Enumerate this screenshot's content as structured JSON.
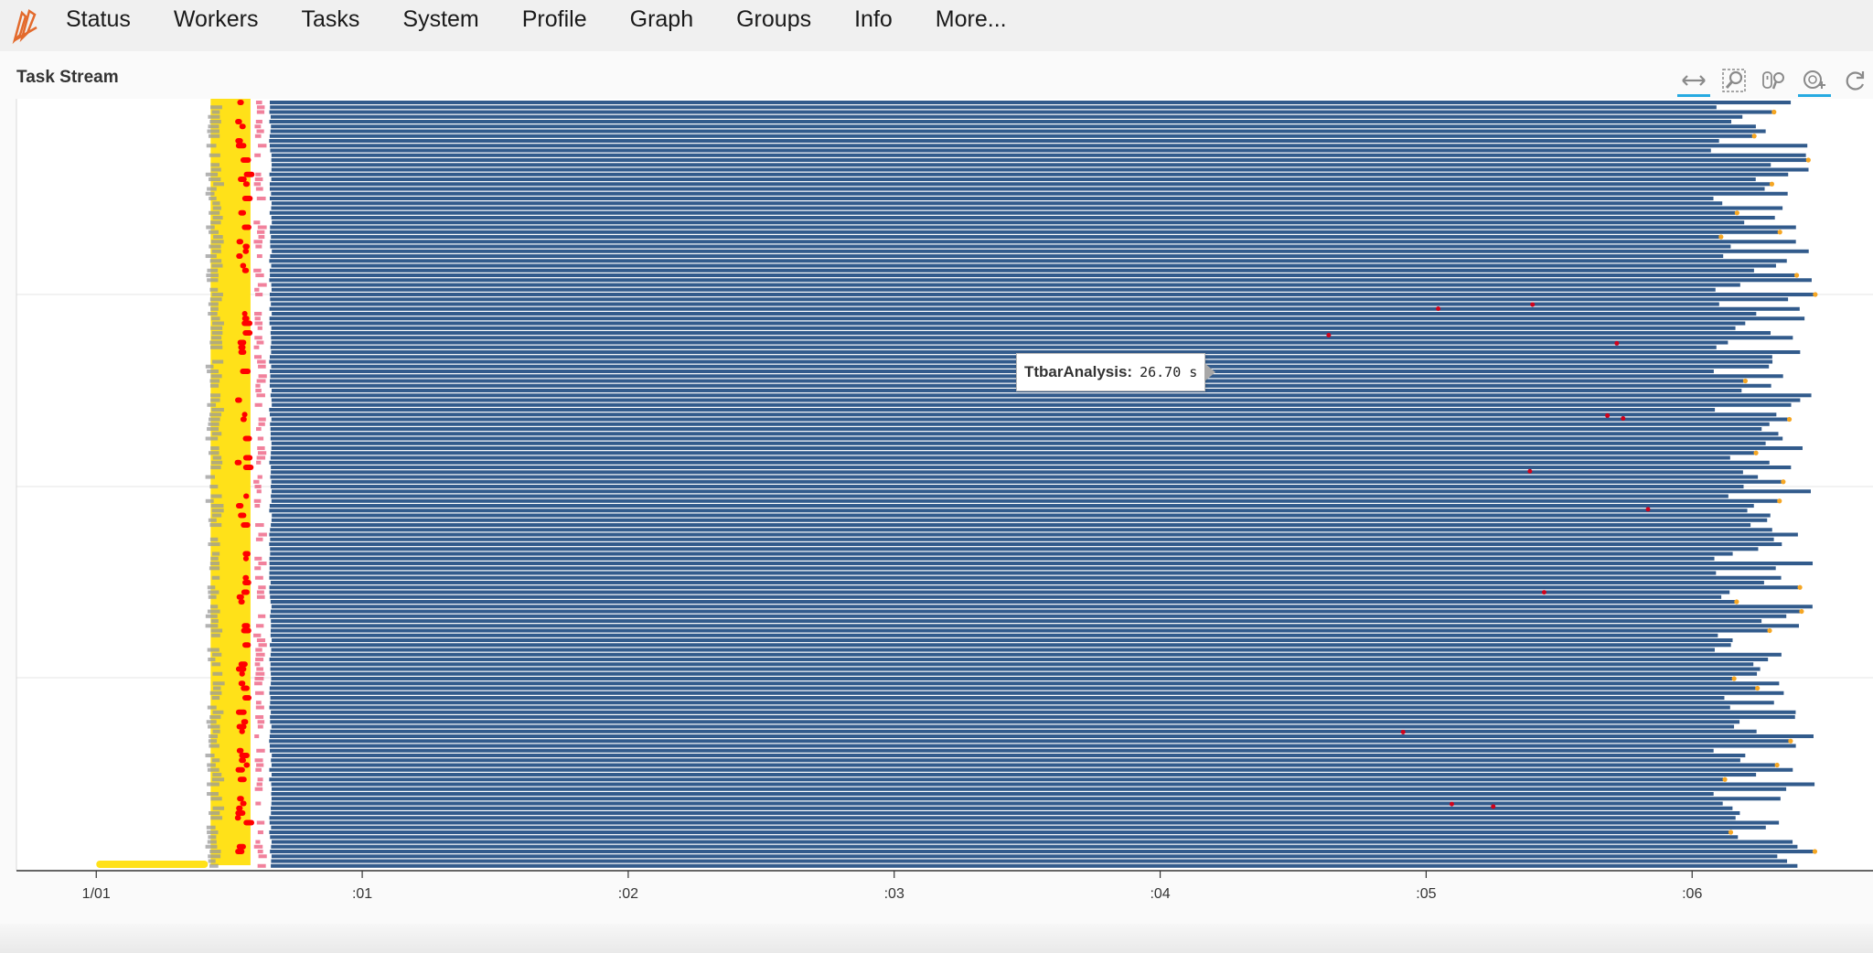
{
  "nav": {
    "items": [
      {
        "id": "status",
        "label": "Status"
      },
      {
        "id": "workers",
        "label": "Workers"
      },
      {
        "id": "tasks",
        "label": "Tasks"
      },
      {
        "id": "system",
        "label": "System"
      },
      {
        "id": "profile",
        "label": "Profile"
      },
      {
        "id": "graph",
        "label": "Graph"
      },
      {
        "id": "groups",
        "label": "Groups"
      },
      {
        "id": "info",
        "label": "Info"
      },
      {
        "id": "more",
        "label": "More..."
      }
    ]
  },
  "panel": {
    "title": "Task Stream"
  },
  "toolbar": {
    "tools": [
      {
        "icon": "pan-icon",
        "active": true
      },
      {
        "icon": "box-zoom-icon",
        "active": false
      },
      {
        "icon": "wheel-zoom-icon",
        "active": false
      },
      {
        "icon": "hover-icon",
        "active": true
      },
      {
        "icon": "reset-icon",
        "active": false
      }
    ]
  },
  "tooltip": {
    "label": "TtbarAnalysis:",
    "value": "26.70 s"
  },
  "colors": {
    "accent": "#26aae1",
    "logo": "#e36a2c",
    "task_main": "#325b8c",
    "task_load": "#ffe119",
    "task_transfer": "#e6194b",
    "task_red": "#ff0000",
    "task_gray": "#9a9a9a",
    "task_orange": "#f5a623"
  },
  "chart_data": {
    "type": "bar",
    "title": "Task Stream",
    "xlabel": "",
    "ylabel": "",
    "x_ticks": [
      "1/01",
      ":01",
      ":02",
      ":03",
      ":04",
      ":05",
      ":06"
    ],
    "x_tick_values": [
      0,
      1,
      2,
      3,
      4,
      5,
      6
    ],
    "xlim": [
      -0.3,
      6.68
    ],
    "rows": 160,
    "series": [
      {
        "name": "",
        "color": "#9a9a9a",
        "start": 0.41,
        "end": 0.46
      },
      {
        "name": "",
        "color": "#ffe119",
        "start": 0.43,
        "end": 0.58
      },
      {
        "name": "",
        "color": "#ff0000",
        "start": 0.52,
        "end": 0.58
      },
      {
        "name": "",
        "color": "#e6194b",
        "start": 0.59,
        "end": 0.64
      },
      {
        "name": "TtbarAnalysis",
        "color": "#325b8c",
        "start": 0.66,
        "end_range": [
          6.07,
          6.47
        ]
      }
    ],
    "baseline": {
      "color": "#ffe119",
      "start": 0.0,
      "end": 0.42
    },
    "grid": true,
    "legend": "none"
  }
}
